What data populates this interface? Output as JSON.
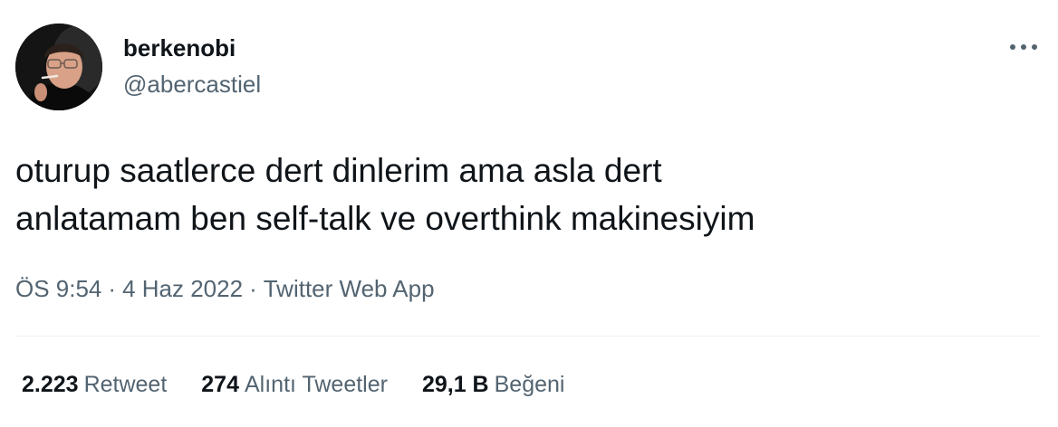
{
  "author": {
    "display_name": "berkenobi",
    "handle": "@abercastiel",
    "avatar_icon": "profile-photo"
  },
  "more_icon": "more-dots-icon",
  "tweet": {
    "text": "oturup saatlerce dert dinlerim ama asla dert\nanlatamam ben self-talk ve overthink makinesiyim"
  },
  "meta": {
    "time": "ÖS 9:54",
    "separator": "·",
    "date": "4 Haz 2022",
    "source": "Twitter Web App"
  },
  "stats": {
    "retweets": {
      "count": "2.223",
      "label": "Retweet"
    },
    "quotes": {
      "count": "274",
      "label": "Alıntı Tweetler"
    },
    "likes": {
      "count": "29,1 B",
      "label": "Beğeni"
    }
  },
  "colors": {
    "primary_text": "#0f1419",
    "secondary_text": "#536471",
    "divider": "#eff3f4",
    "background": "#ffffff"
  }
}
